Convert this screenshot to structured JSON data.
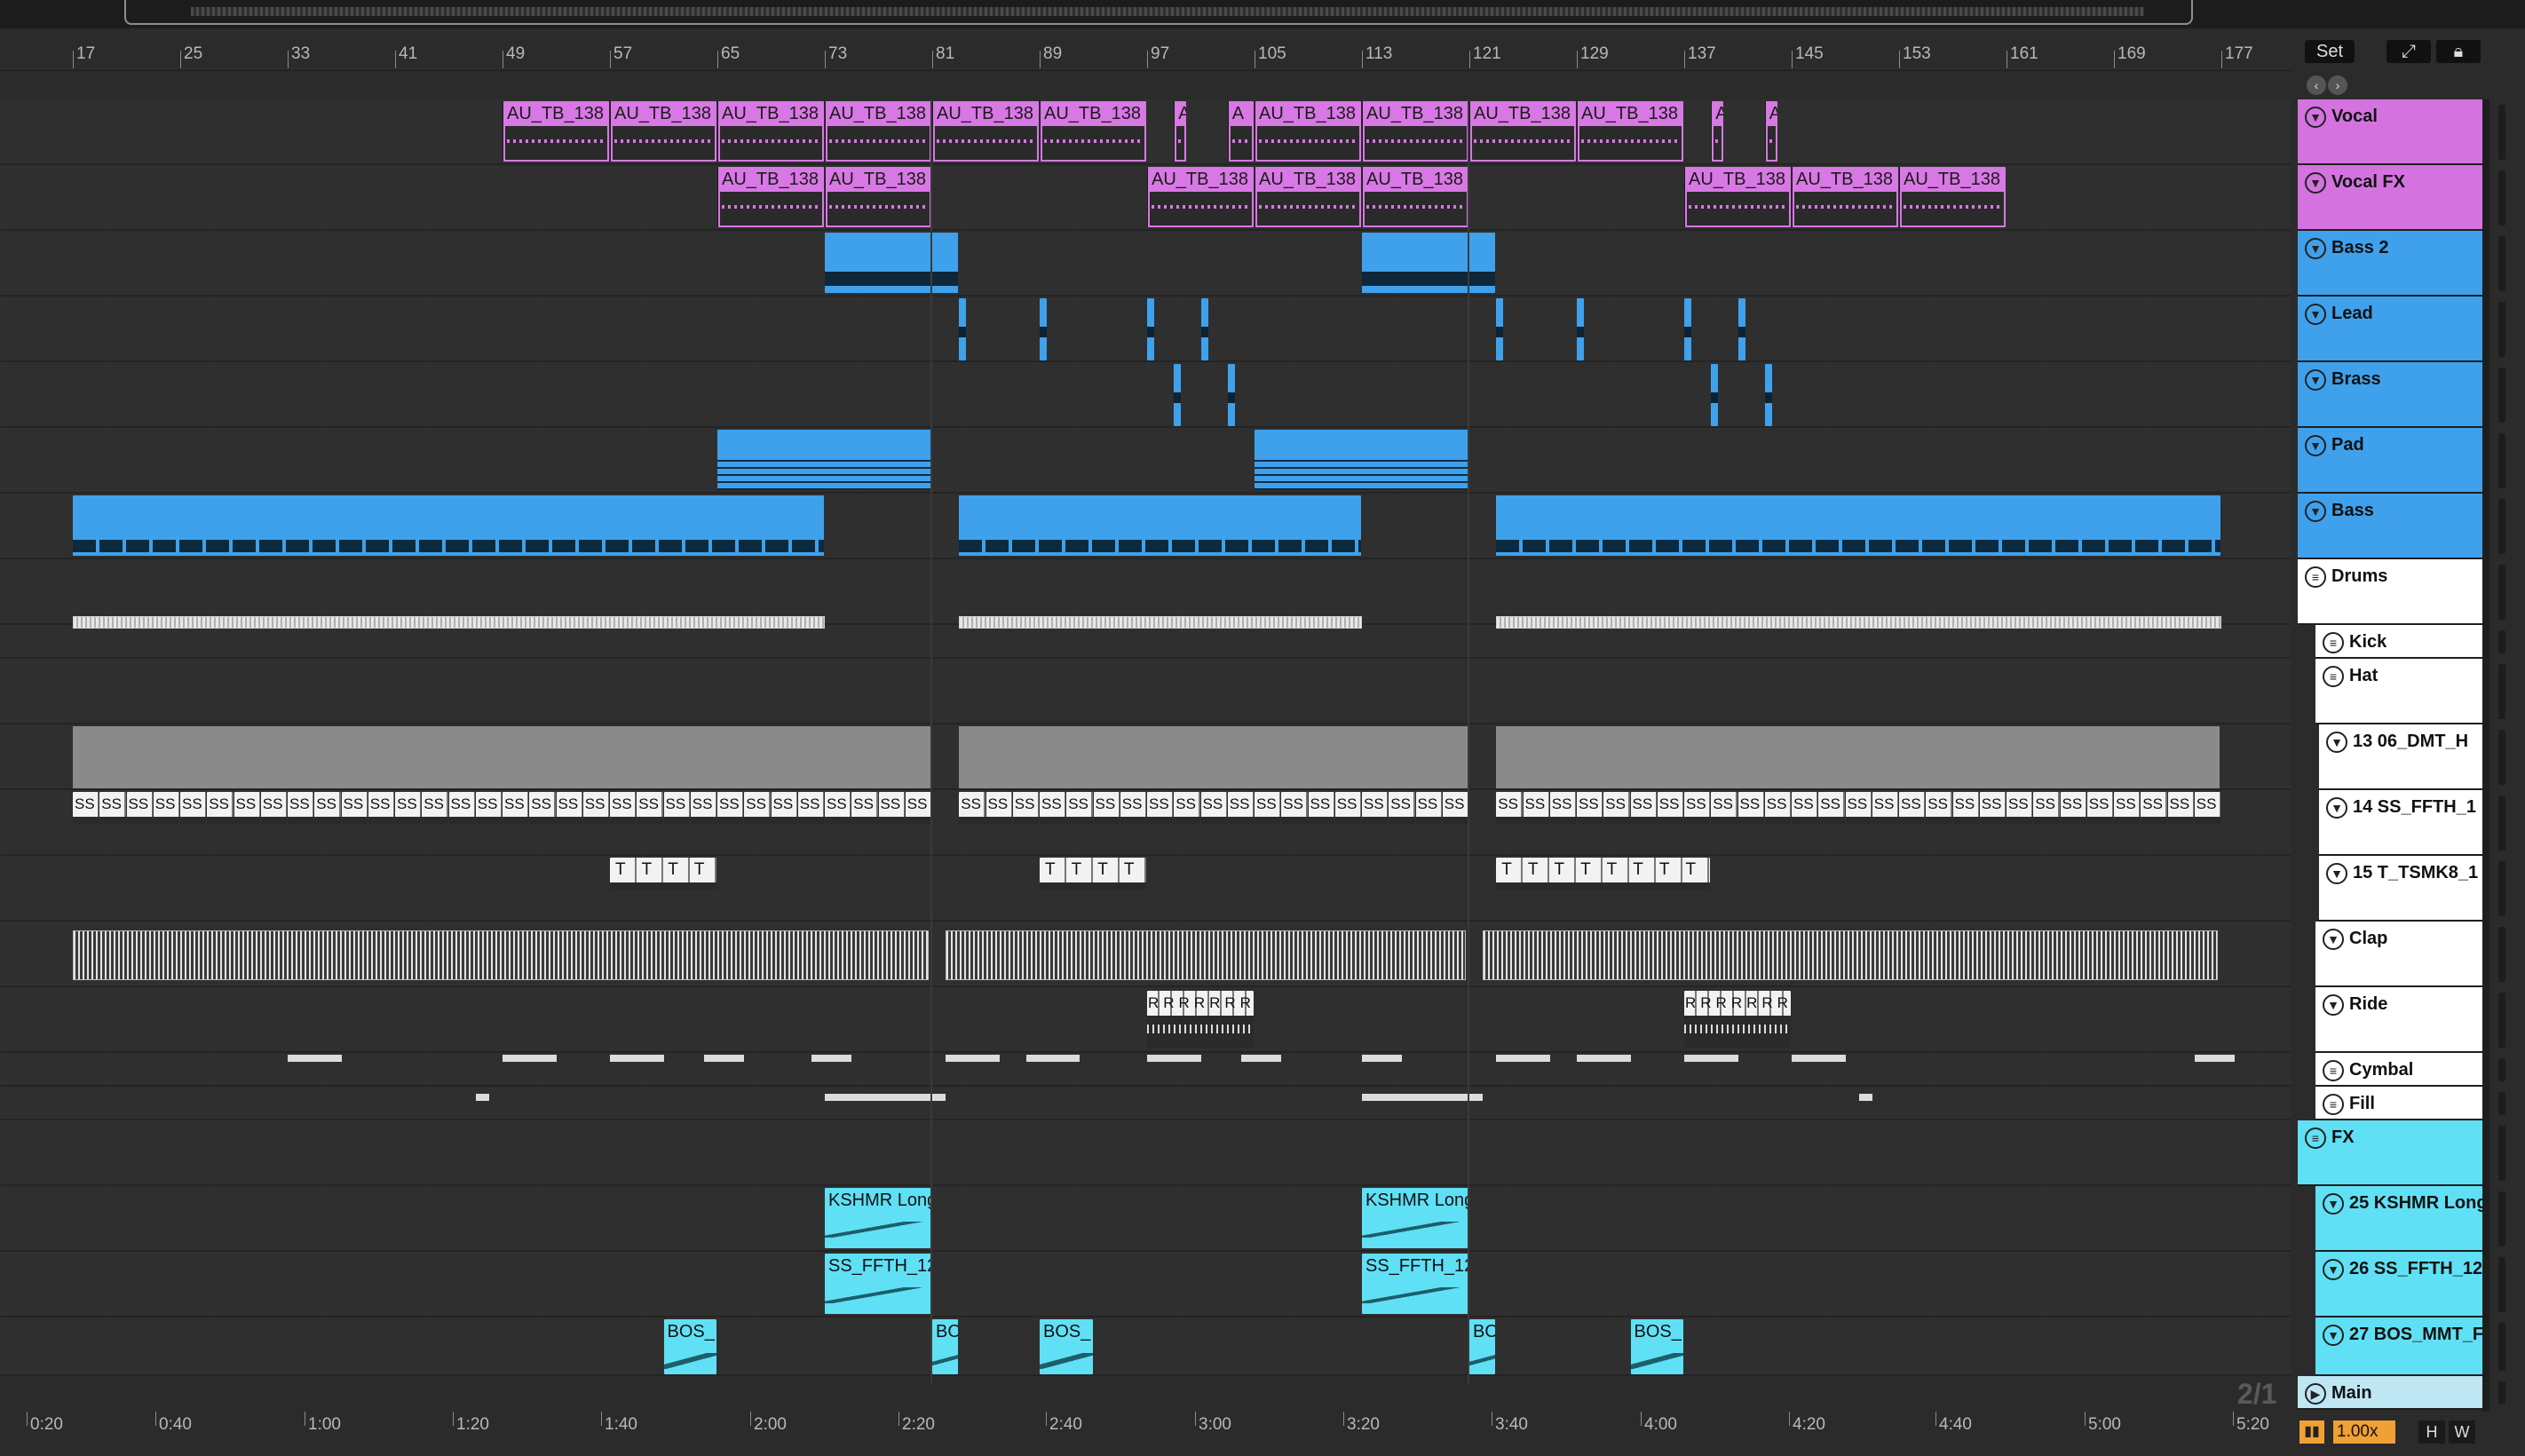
{
  "ruler": {
    "bars": [
      "17",
      "25",
      "33",
      "41",
      "49",
      "57",
      "65",
      "73",
      "81",
      "89",
      "97",
      "105",
      "113",
      "121",
      "129",
      "137",
      "145",
      "153",
      "161",
      "169",
      "177"
    ]
  },
  "timeline": {
    "labels": [
      "0:20",
      "0:40",
      "1:00",
      "1:20",
      "1:40",
      "2:00",
      "2:20",
      "2:40",
      "3:00",
      "3:20",
      "3:40",
      "4:00",
      "4:20",
      "4:40",
      "5:00",
      "5:20"
    ]
  },
  "controls": {
    "set_label": "Set",
    "expand_icon": "expand-icon",
    "lock_icon": "lock-icon",
    "time_signature": "2/1",
    "zoom": "1.00x",
    "h_label": "H",
    "w_label": "W"
  },
  "tracks": [
    {
      "name": "Vocal",
      "color": "#d473e0",
      "icon": "chevron-circle-icon"
    },
    {
      "name": "Vocal FX",
      "color": "#d473e0",
      "icon": "chevron-circle-icon"
    },
    {
      "name": "Bass 2",
      "color": "#3fa1ec",
      "icon": "chevron-circle-icon"
    },
    {
      "name": "Lead",
      "color": "#3fa1ec",
      "icon": "chevron-circle-icon"
    },
    {
      "name": "Brass",
      "color": "#3fa1ec",
      "icon": "chevron-circle-icon"
    },
    {
      "name": "Pad",
      "color": "#3fa1ec",
      "icon": "chevron-circle-icon"
    },
    {
      "name": "Bass",
      "color": "#3fa1ec",
      "icon": "chevron-circle-icon"
    },
    {
      "name": "Drums",
      "color": "#ffffff",
      "icon": "group-icon"
    },
    {
      "name": "Kick",
      "color": "#ffffff",
      "icon": "group-icon"
    },
    {
      "name": "Hat",
      "color": "#ffffff",
      "icon": "group-icon"
    },
    {
      "name": "13 06_DMT_H",
      "color": "#ffffff",
      "icon": "chevron-circle-icon"
    },
    {
      "name": "14 SS_FFTH_1",
      "color": "#ffffff",
      "icon": "chevron-circle-icon"
    },
    {
      "name": "15 T_TSMK8_1",
      "color": "#ffffff",
      "icon": "chevron-circle-icon"
    },
    {
      "name": "Clap",
      "color": "#ffffff",
      "icon": "chevron-circle-icon"
    },
    {
      "name": "Ride",
      "color": "#ffffff",
      "icon": "chevron-circle-icon"
    },
    {
      "name": "Cymbal",
      "color": "#ffffff",
      "icon": "group-icon"
    },
    {
      "name": "Fill",
      "color": "#ffffff",
      "icon": "group-icon"
    },
    {
      "name": "FX",
      "color": "#5fe0f5",
      "icon": "group-icon"
    },
    {
      "name": "25 KSHMR Long",
      "color": "#5fe0f5",
      "icon": "chevron-circle-icon"
    },
    {
      "name": "26 SS_FFTH_12",
      "color": "#5fe0f5",
      "icon": "chevron-circle-icon"
    },
    {
      "name": "27 BOS_MMT_F",
      "color": "#5fe0f5",
      "icon": "chevron-circle-icon"
    },
    {
      "name": "Main",
      "color": "#bfe6f3",
      "icon": "play-circle-icon"
    }
  ],
  "clips": {
    "vocal": "AU_TB_138",
    "vocal_short": "A",
    "ss": "SS",
    "t": "TTTT",
    "t8": "TTTTTTTT",
    "t11": "TTTTTTTTTTT",
    "r": "RRRRRRRR",
    "kshmr": "KSHMR Long",
    "ssffth": "SS_FFTH_12",
    "bos": "BOS_",
    "bo": "BO"
  }
}
